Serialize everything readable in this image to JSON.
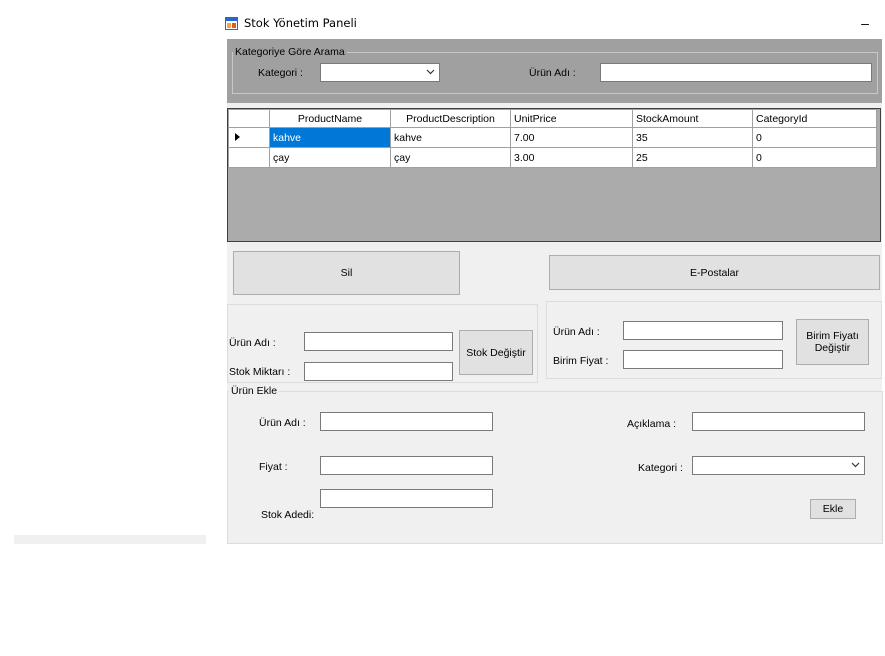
{
  "window": {
    "title": "Stok Yönetim Paneli",
    "minimize_glyph": "–"
  },
  "search": {
    "legend": "Kategoriye Göre Arama",
    "category_label": "Kategori :",
    "category_value": "",
    "product_name_label": "Ürün Adı :",
    "product_name_value": ""
  },
  "grid": {
    "columns": [
      "ProductName",
      "ProductDescription",
      "UnitPrice",
      "StockAmount",
      "CategoryId"
    ],
    "rows": [
      {
        "current": true,
        "cells": [
          "kahve",
          "kahve",
          "7.00",
          "35",
          "0"
        ]
      },
      {
        "current": false,
        "cells": [
          "çay",
          "çay",
          "3.00",
          "25",
          "0"
        ]
      }
    ]
  },
  "buttons": {
    "delete": "Sil",
    "emails": "E-Postalar"
  },
  "stock_change": {
    "name_label": "Ürün Adı :",
    "name_value": "",
    "amount_label": "Stok Miktarı :",
    "amount_value": "",
    "button": "Stok Değiştir"
  },
  "price_change": {
    "name_label": "Ürün Adı :",
    "name_value": "",
    "price_label": "Birim Fiyat :",
    "price_value": "",
    "button_line1": "Birim Fiyatı",
    "button_line2": "Değiştir"
  },
  "add_product": {
    "legend": "Ürün Ekle",
    "name_label": "Ürün Adı :",
    "price_label": "Fiyat  :",
    "stock_label": "Stok Adedi:",
    "description_label": "Açıklama :",
    "category_label": "Kategori :",
    "button": "Ekle",
    "name_value": "",
    "price_value": "",
    "stock_value": "",
    "description_value": "",
    "category_value": ""
  },
  "colors": {
    "selection": "#0078d7",
    "panel_gray": "#a0a0a0",
    "form_bg": "#f0f0f0"
  },
  "icons": {
    "app": "app-window-icon",
    "dropdown": "chevron-down-icon",
    "row_pointer": "current-row-pointer-icon"
  }
}
